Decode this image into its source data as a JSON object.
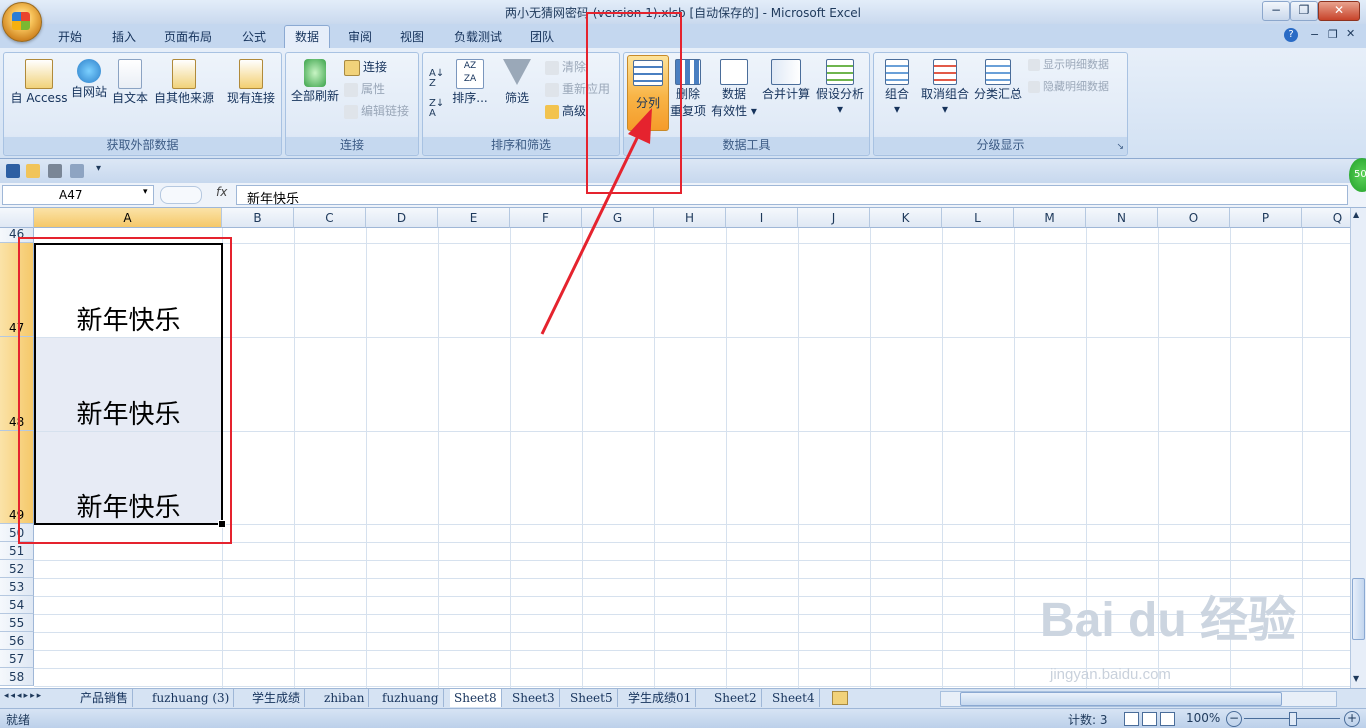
{
  "window": {
    "title": "两小无猜网密码 (version 1).xlsb  [自动保存的] - Microsoft Excel",
    "min": "−",
    "restore": "❐",
    "close": "✕"
  },
  "tabs": [
    "开始",
    "插入",
    "页面布局",
    "公式",
    "数据",
    "审阅",
    "视图",
    "负载测试",
    "团队"
  ],
  "active_tab": "数据",
  "ribbon": {
    "external": {
      "label": "获取外部数据",
      "buttons": [
        "自 Access",
        "自网站",
        "自文本",
        "自其他来源",
        "现有连接"
      ]
    },
    "connections": {
      "label": "连接",
      "refresh": "全部刷新",
      "items": [
        "连接",
        "属性",
        "编辑链接"
      ]
    },
    "sort": {
      "label": "排序和筛选",
      "sort": "排序...",
      "filter": "筛选",
      "clear": "清除",
      "reapply": "重新应用",
      "advanced": "高级"
    },
    "tools": {
      "label": "数据工具",
      "split": "分列",
      "dedup_1": "删除",
      "dedup_2": "重复项",
      "valid_1": "数据",
      "valid_2": "有效性",
      "consolidate": "合并计算",
      "whatif": "假设分析"
    },
    "outline": {
      "label": "分级显示",
      "group": "组合",
      "ungroup": "取消组合",
      "subtotal": "分类汇总",
      "show": "显示明细数据",
      "hide": "隐藏明细数据"
    }
  },
  "formula_bar": {
    "name": "A47",
    "fx": "fx",
    "value": "新年快乐"
  },
  "columns": [
    "A",
    "B",
    "C",
    "D",
    "E",
    "F",
    "G",
    "H",
    "I",
    "J",
    "K",
    "L",
    "M",
    "N",
    "O",
    "P",
    "Q"
  ],
  "rows": {
    "r46": "46",
    "r47": "47",
    "r48": "48",
    "r49": "49",
    "small": [
      "50",
      "51",
      "52",
      "53",
      "54",
      "55",
      "56",
      "57",
      "58"
    ]
  },
  "cells": {
    "a47": "新年快乐",
    "a48": "新年快乐",
    "a49": "新年快乐"
  },
  "sheets": [
    "产品销售",
    "fuzhuang (3)",
    "学生成绩",
    "zhiban",
    "fuzhuang",
    "Sheet8",
    "Sheet3",
    "Sheet5",
    "学生成绩01",
    "Sheet2",
    "Sheet4"
  ],
  "active_sheet": "Sheet8",
  "status": {
    "ready": "就绪",
    "count": "计数: 3",
    "zoom": "100%"
  },
  "badge": "50",
  "watermark": {
    "brand": "Bai du 经验",
    "url": "jingyan.baidu.com"
  }
}
